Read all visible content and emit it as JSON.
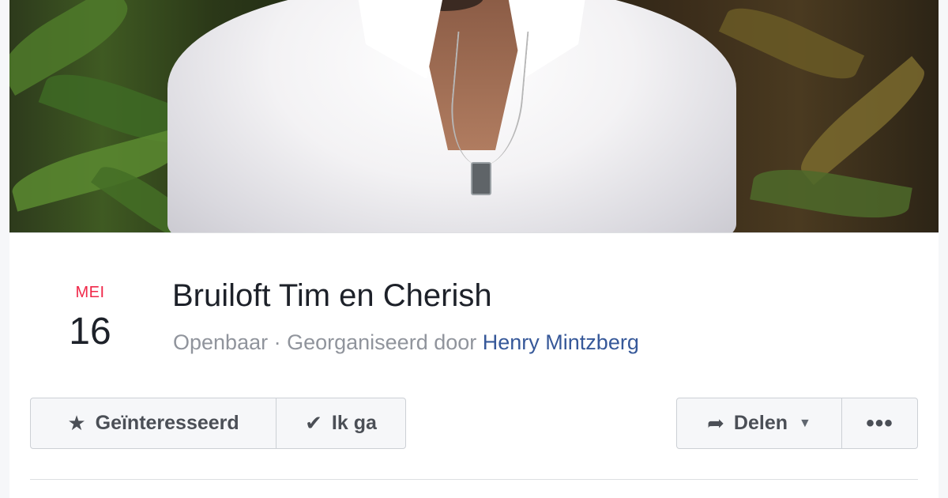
{
  "event": {
    "month": "MEI",
    "day": "16",
    "title": "Bruiloft Tim en Cherish",
    "visibility": "Openbaar",
    "separator": " · ",
    "organized_by_prefix": "Georganiseerd door",
    "organizer": "Henry Mintzberg"
  },
  "actions": {
    "interested": {
      "label": "Geïnteresseerd",
      "icon": "star-icon"
    },
    "going": {
      "label": "Ik ga",
      "icon": "checkmark-icon"
    },
    "share": {
      "label": "Delen",
      "icon": "share-arrow-icon",
      "caret": "chevron-down-icon"
    },
    "more": {
      "label": "•••",
      "icon": "more-dots-icon"
    }
  },
  "colors": {
    "month_red": "#f02849",
    "link_blue": "#365899",
    "text_dark": "#1d2129",
    "text_gray": "#90949c"
  }
}
